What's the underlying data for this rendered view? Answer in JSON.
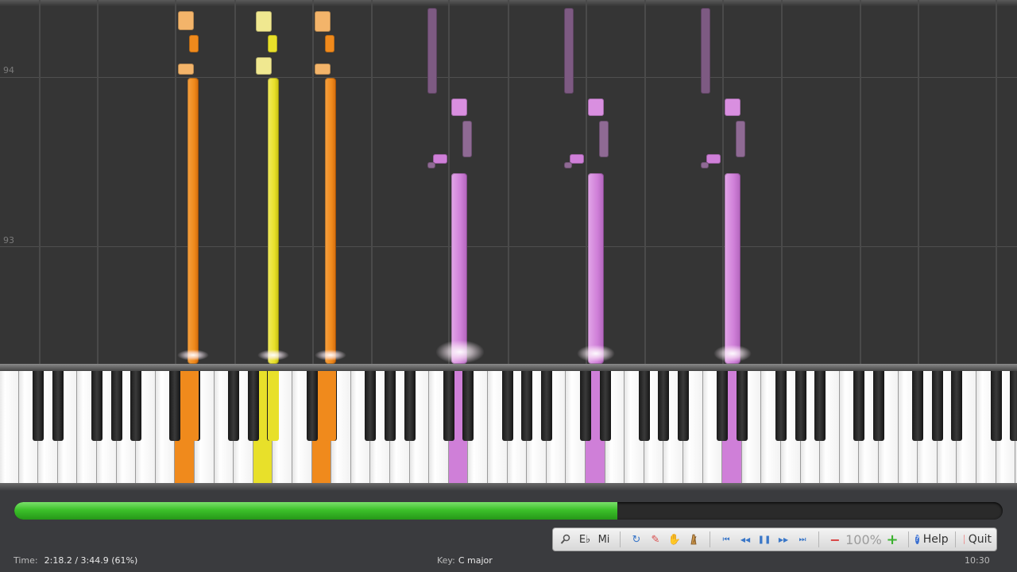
{
  "roll": {
    "measure_labels": [
      "94",
      "93"
    ]
  },
  "colors": {
    "orange": "#f08a1c",
    "yellow": "#e8e02a",
    "purple": "#cf7fd8",
    "purple_dim": "#7d5a82",
    "progress_green": "#3cc02a"
  },
  "toolbar": {
    "magnify_icon": "magnify-icon",
    "key_label": "E♭",
    "note_label": "Mi",
    "loop_icon": "loop-icon",
    "pencil_icon": "pencil-icon",
    "hand_icon": "hand-icon",
    "metronome_icon": "metronome-icon",
    "rewind_start": "⏮",
    "rewind": "◀◀",
    "pause": "❚❚",
    "forward": "▶▶",
    "forward_end": "⏭",
    "zoom_minus": "−",
    "zoom_value": "100%",
    "zoom_plus": "+",
    "help_label": "Help",
    "quit_label": "Quit"
  },
  "progress": {
    "fraction": 0.61
  },
  "status": {
    "time_label": "Time:",
    "time_value": "2:18.2 / 3:44.9 (61%)",
    "key_label": "Key:",
    "key_value": "C major",
    "clock": "10:30"
  }
}
